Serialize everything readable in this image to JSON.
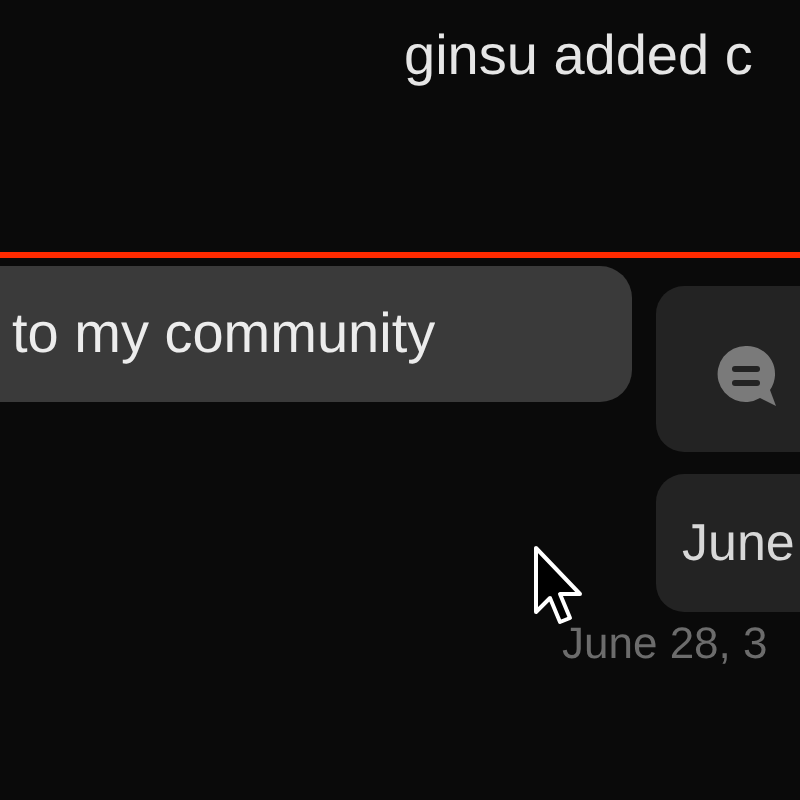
{
  "notice": {
    "text": "ginsu added c"
  },
  "message": {
    "text": "to my community"
  },
  "date_card": {
    "text": "June"
  },
  "timestamp": {
    "text": "June 28, 3"
  }
}
